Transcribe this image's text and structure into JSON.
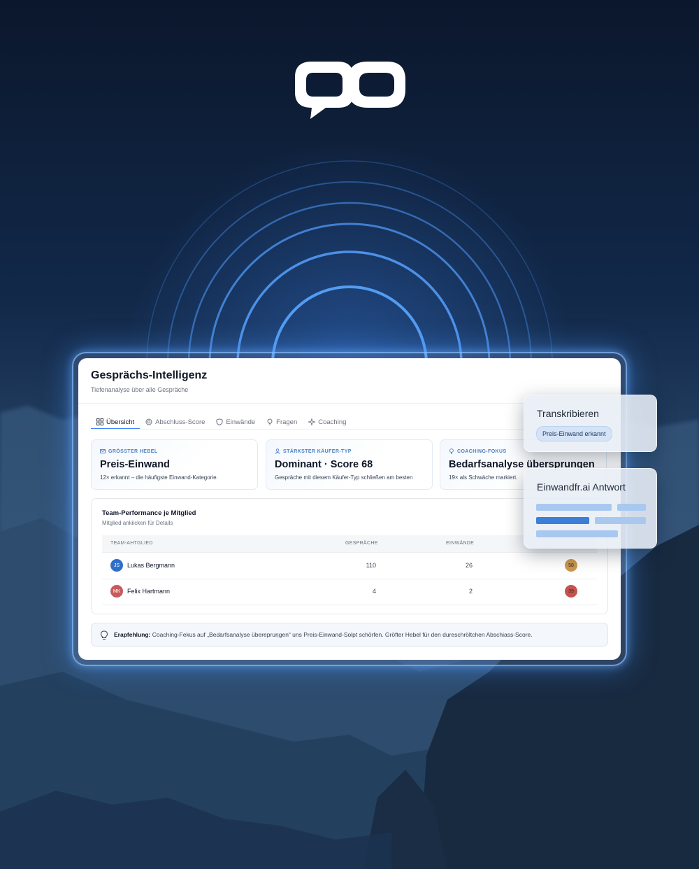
{
  "app": {
    "title": "Gesprächs-Intelligenz",
    "subtitle": "Tiefenanalyse über alle Gespräche"
  },
  "tabs": [
    {
      "label": "Übersicht",
      "icon": "grid-icon",
      "active": true
    },
    {
      "label": "Abschluss-Score",
      "icon": "target-icon",
      "active": false
    },
    {
      "label": "Einwände",
      "icon": "shield-icon",
      "active": false
    },
    {
      "label": "Fragen",
      "icon": "lightbulb-icon",
      "active": false
    },
    {
      "label": "Coaching",
      "icon": "sparkle-icon",
      "active": false
    }
  ],
  "kpis": [
    {
      "label": "GRÖSSTER HEBEL",
      "icon": "mail-icon",
      "value": "Preis-Einwand",
      "desc": "12× erkannt – die häufigste Einwand-Kategorie."
    },
    {
      "label": "STÄRKSTER KÄUFER-TYP",
      "icon": "user-icon",
      "value": "Dominant · Score 68",
      "desc": "Gespräche mit diesem Käufer-Typ schließen am besten"
    },
    {
      "label": "COACHING-FOKUS",
      "icon": "lightbulb-icon",
      "value": "Bedarfsanalyse übersprungen",
      "desc": "19× als Schwäche markiert."
    }
  ],
  "team": {
    "title": "Team-Performance je Mitglied",
    "subtitle": "Mitglied ankiicken für Details",
    "columns": [
      "TEAM-AHTGLIED",
      "GESPRÄCHE",
      "EINWÄNDE"
    ],
    "rows": [
      {
        "initials": "JS",
        "name": "Lukas Bergmann",
        "calls": "110",
        "objections": "26",
        "score": "58",
        "avatar_color": "#2f6fc9",
        "score_color": "#c9974f"
      },
      {
        "initials": "MK",
        "name": "Felix Hartmann",
        "calls": "4",
        "objections": "2",
        "score": "39",
        "avatar_color": "#c75a5a",
        "score_color": "#c4534f"
      }
    ]
  },
  "recommendation": {
    "label": "Erapfehlung:",
    "text": "Coaching-Fekus auf „Bedarfsanalyse überepruṇgen“ uns Preis-Einwand-Solpt schörfen. Gröfter Hebel für den dureschröltchen Abschiass-Score."
  },
  "panel_transcribe": {
    "title": "Transkribieren",
    "chip": "Preis-Einwand erkannt"
  },
  "panel_answer": {
    "title": "Einwandfr.ai Antwort"
  },
  "colors": {
    "accent": "#3b82f6",
    "background": "#0d1b33",
    "kpi_label": "#4a7fc4"
  }
}
